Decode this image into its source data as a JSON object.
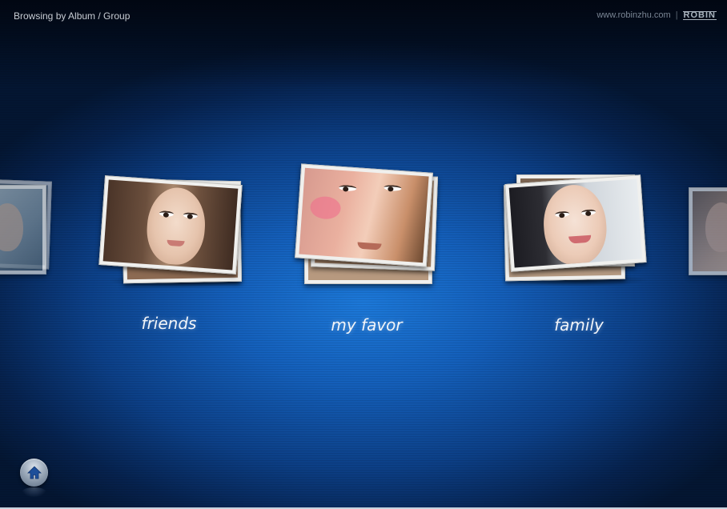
{
  "header": {
    "title": "Browsing by Album / Group",
    "site": "www.robinzhu.com",
    "separator": "|",
    "brand": "ROBIN"
  },
  "albums": [
    {
      "label": ""
    },
    {
      "label": "friends"
    },
    {
      "label": "my favor"
    },
    {
      "label": "family"
    },
    {
      "label": ""
    }
  ],
  "footer": {
    "home_icon": "home-icon"
  },
  "colors": {
    "background_center": "#1c78d8",
    "background_edge": "#041632",
    "label_text": "#f2f5f9",
    "card_frame": "#f0f0ee"
  }
}
